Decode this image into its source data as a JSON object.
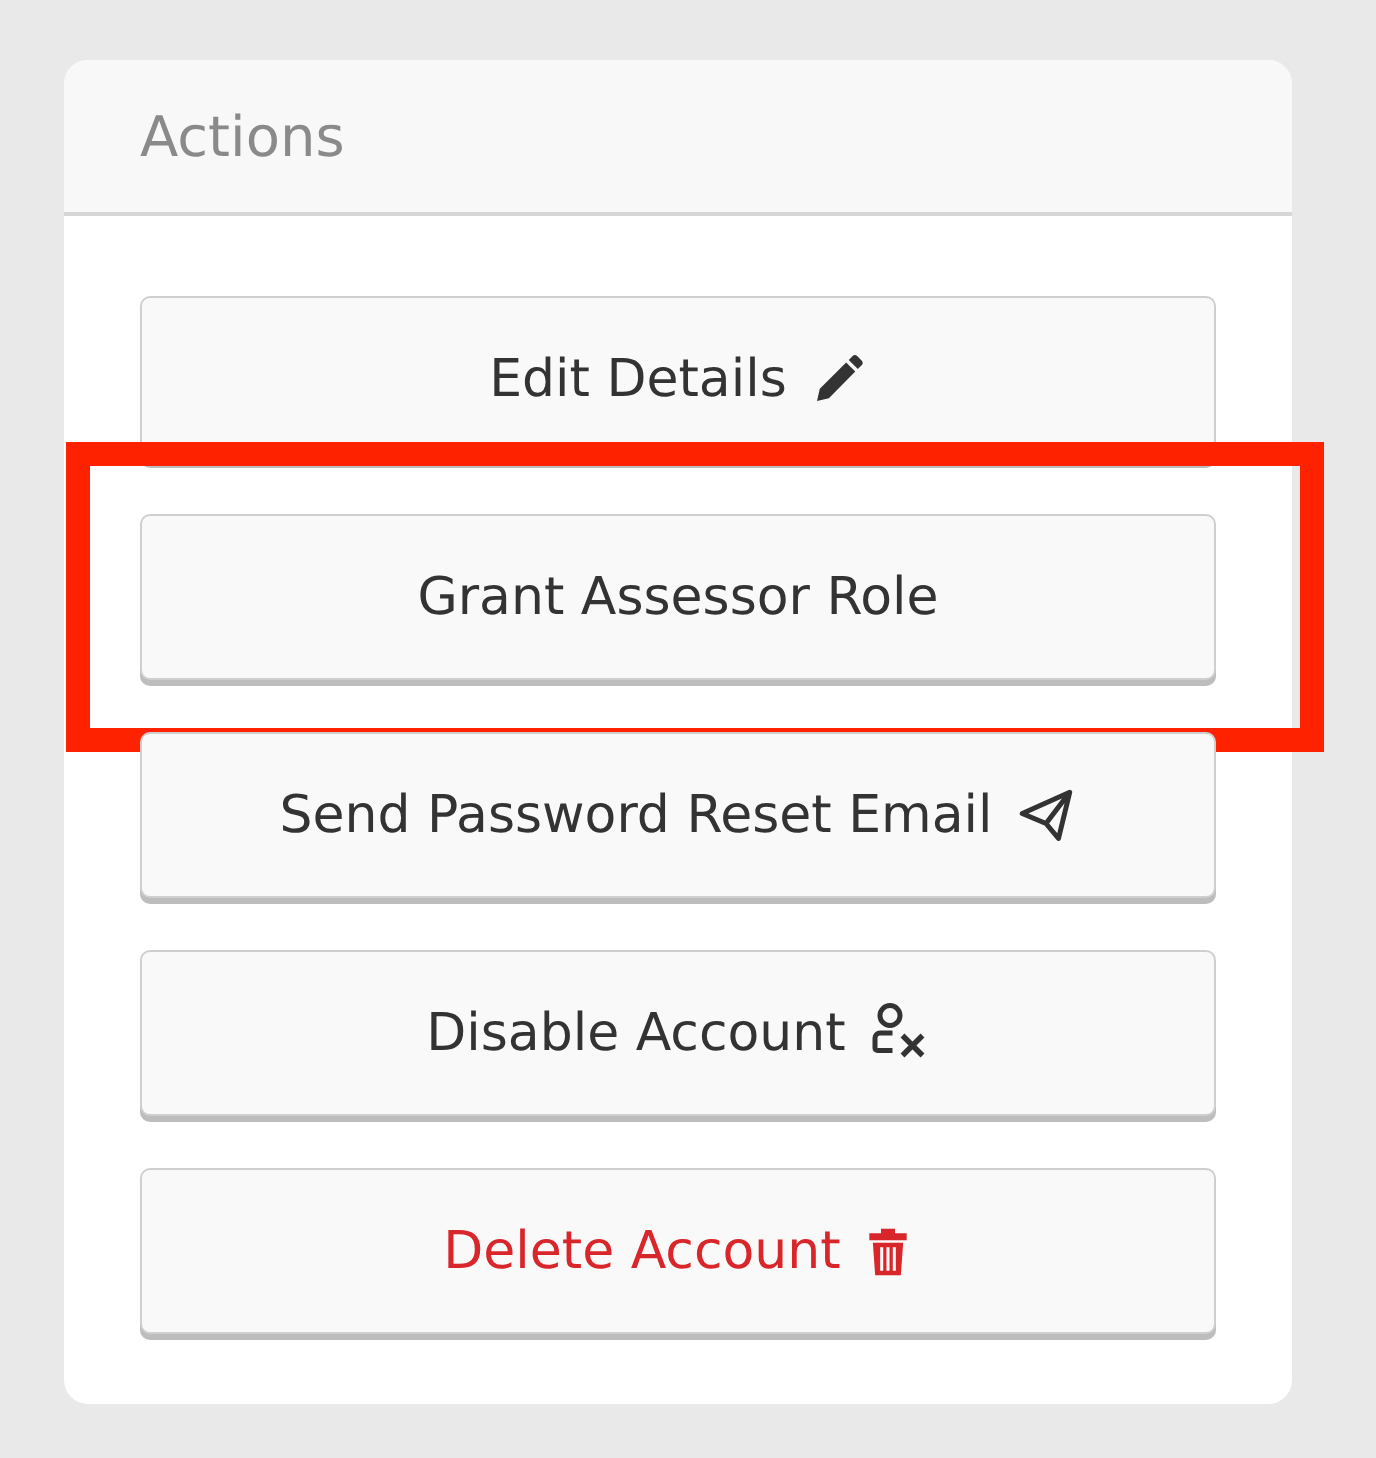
{
  "panel": {
    "title": "Actions"
  },
  "buttons": [
    {
      "label": "Edit Details",
      "kind": "edit",
      "danger": false,
      "highlighted": false
    },
    {
      "label": "Grant Assessor Role",
      "kind": "plain",
      "danger": false,
      "highlighted": true
    },
    {
      "label": "Send Password Reset Email",
      "kind": "mail",
      "danger": false,
      "highlighted": false
    },
    {
      "label": "Disable Account",
      "kind": "disable",
      "danger": false,
      "highlighted": false
    },
    {
      "label": "Delete Account",
      "kind": "delete",
      "danger": true,
      "highlighted": false
    }
  ]
}
